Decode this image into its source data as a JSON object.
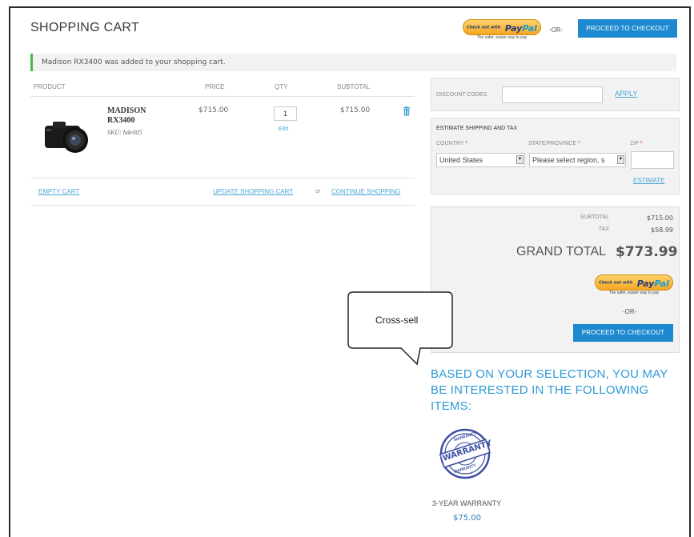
{
  "header": {
    "title": "SHOPPING CART",
    "paypal": {
      "checkout_with": "Check out with",
      "brand_1": "Pay",
      "brand_2": "Pal",
      "tagline": "The safer, easier way to pay"
    },
    "or": "-OR-",
    "checkout_button": "PROCEED TO CHECKOUT"
  },
  "message": {
    "text": "Madison RX3400 was added to your shopping cart."
  },
  "cart_table": {
    "columns": [
      "PRODUCT",
      "PRICE",
      "QTY",
      "SUBTOTAL"
    ],
    "items": [
      {
        "name": "MADISON RX3400",
        "sku": "SKU: hde005",
        "price": "$715.00",
        "qty": "1",
        "edit": "Edit",
        "subtotal": "$715.00"
      }
    ],
    "empty_cart": "EMPTY CART",
    "update_cart": "UPDATE SHOPPING CART",
    "or": "or",
    "continue_shopping": "CONTINUE SHOPPING"
  },
  "discount": {
    "label": "DISCOUNT CODES",
    "value": "",
    "apply": "APPLY"
  },
  "shipping": {
    "title": "ESTIMATE SHIPPING AND TAX",
    "country_label": "COUNTRY",
    "state_label": "STATE/PROVINCE",
    "zip_label": "ZIP",
    "required_mark": "*",
    "country_value": "United States",
    "state_value": "Please select region, s",
    "zip_value": "",
    "estimate": "ESTIMATE"
  },
  "totals": {
    "subtotal_label": "SUBTOTAL",
    "subtotal_value": "$715.00",
    "tax_label": "TAX",
    "tax_value": "$58.99",
    "grand_total_label": "GRAND TOTAL",
    "grand_total_value": "$773.99",
    "or": "-OR-",
    "checkout_button": "PROCEED TO CHECKOUT"
  },
  "callout": {
    "text": "Cross-sell"
  },
  "crosssell": {
    "title": "BASED ON YOUR SELECTION, YOU MAY BE INTERESTED IN THE FOLLOWING ITEMS:",
    "items": [
      {
        "name": "3-YEAR WARRANTY",
        "price": "$75.00",
        "badge_top": "WARRANTY",
        "badge_mid": "WARRANTY",
        "badge_bottom": "WARRANTY"
      }
    ]
  },
  "colors": {
    "accent_blue": "#1d8ad0",
    "link_blue": "#4aa6d6",
    "heading_blue": "#2d9ad8",
    "success_green": "#4ab846"
  },
  "icons": {
    "delete": "trash-icon",
    "dropdown": "chevron-down-icon"
  }
}
